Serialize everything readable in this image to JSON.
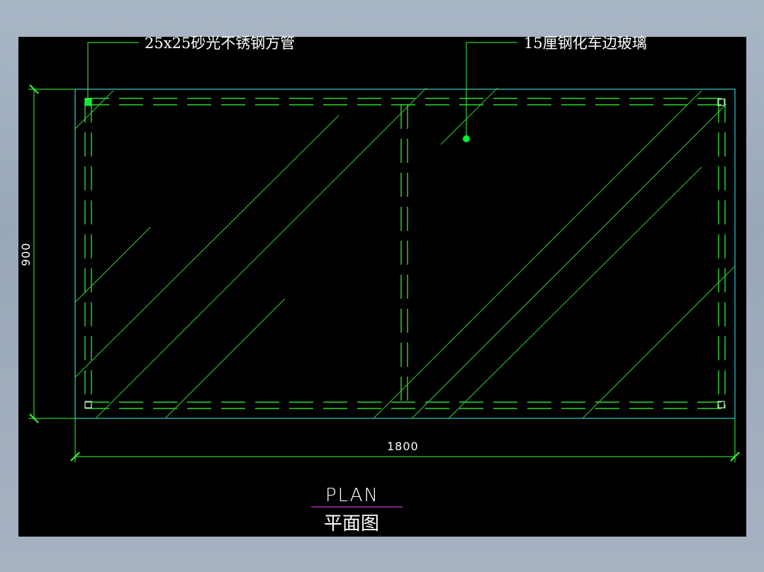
{
  "drawing": {
    "labels": {
      "tube_note": "25x25砂光不锈钢方管",
      "glass_note": "15厘钢化车边玻璃"
    },
    "dimensions": {
      "height": "900",
      "width": "1800"
    },
    "title": {
      "en": "PLAN",
      "zh": "平面图"
    },
    "colors": {
      "background": "#000000",
      "frame_outline": "#33cccc",
      "hidden_lines": "#33ff33",
      "glass_hatch": "#33cc33",
      "leader": "#33ff33",
      "dimension": "#33ff33",
      "text": "#ffffff",
      "title_underline": "#cc33cc",
      "leader_dot": "#00ee33"
    }
  }
}
